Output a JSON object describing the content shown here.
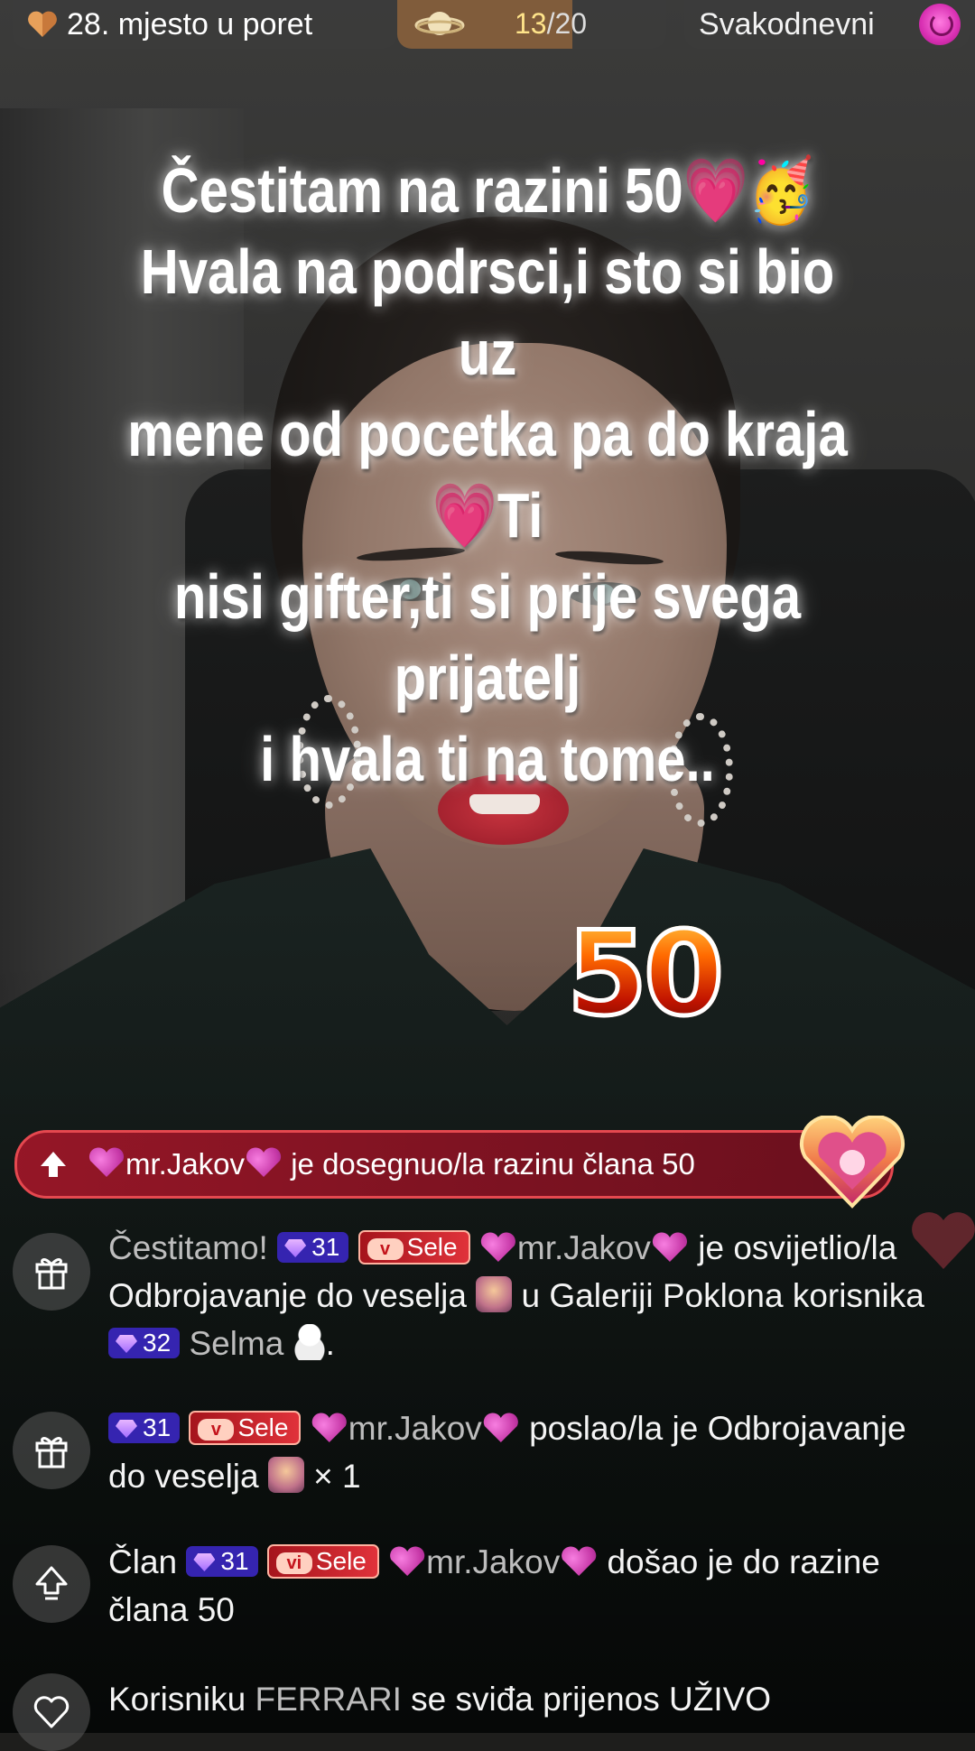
{
  "topbar": {
    "rank_text": "28. mjesto u poret",
    "goal_current": "13",
    "goal_separator": "/",
    "goal_total": "20",
    "goal_progress": 0.65,
    "daily_text": "Svakodnevni"
  },
  "caption": {
    "line1": "Čestitam na razini 50💗🥳",
    "line2": "Hvala na podrsci,i sto si bio uz",
    "line3": "mene od pocetka pa do kraja💗Ti",
    "line4": "nisi gifter,ti si prije svega prijatelj",
    "line5": "i hvala ti na tome.."
  },
  "level_badge": "50",
  "banner": {
    "user": "mr.Jakov",
    "text": "je dosegnuo/la razinu člana 50"
  },
  "chat": [
    {
      "icon": "gift-icon",
      "prefix": "Čestitamo!",
      "level": "31",
      "fan_badge": "Sele",
      "fan_badge_icon": "v",
      "user": "mr.Jakov",
      "text1": "je",
      "text2": "osvijetlio/la  Odbrojavanje do veselja",
      "text3": "u",
      "text4": "Galeriji Poklona korisnika",
      "level2": "32",
      "user2": "Selma",
      "end": "."
    },
    {
      "icon": "gift-icon",
      "level": "31",
      "fan_badge": "Sele",
      "fan_badge_icon": "v",
      "user": "mr.Jakov",
      "text1": "poslao/la je",
      "text2": "Odbrojavanje do veselja",
      "text3": "× 1"
    },
    {
      "icon": "level-up-icon",
      "prefix": "Član",
      "level": "31",
      "fan_badge": "Sele",
      "fan_badge_icon": "vi",
      "user": "mr.Jakov",
      "text1": "došao je do",
      "text2": "razine člana 50"
    },
    {
      "icon": "heart-outline-icon",
      "prefix": "Korisniku",
      "user": "FERRARI",
      "text1": "se sviđa prijenos UŽIVO"
    }
  ],
  "colors": {
    "banner_bg": "#a0162a",
    "level_badge_bg": "#3524b0",
    "fan_badge_bg": "#c4141c",
    "goal_text": "#ffe48a"
  }
}
